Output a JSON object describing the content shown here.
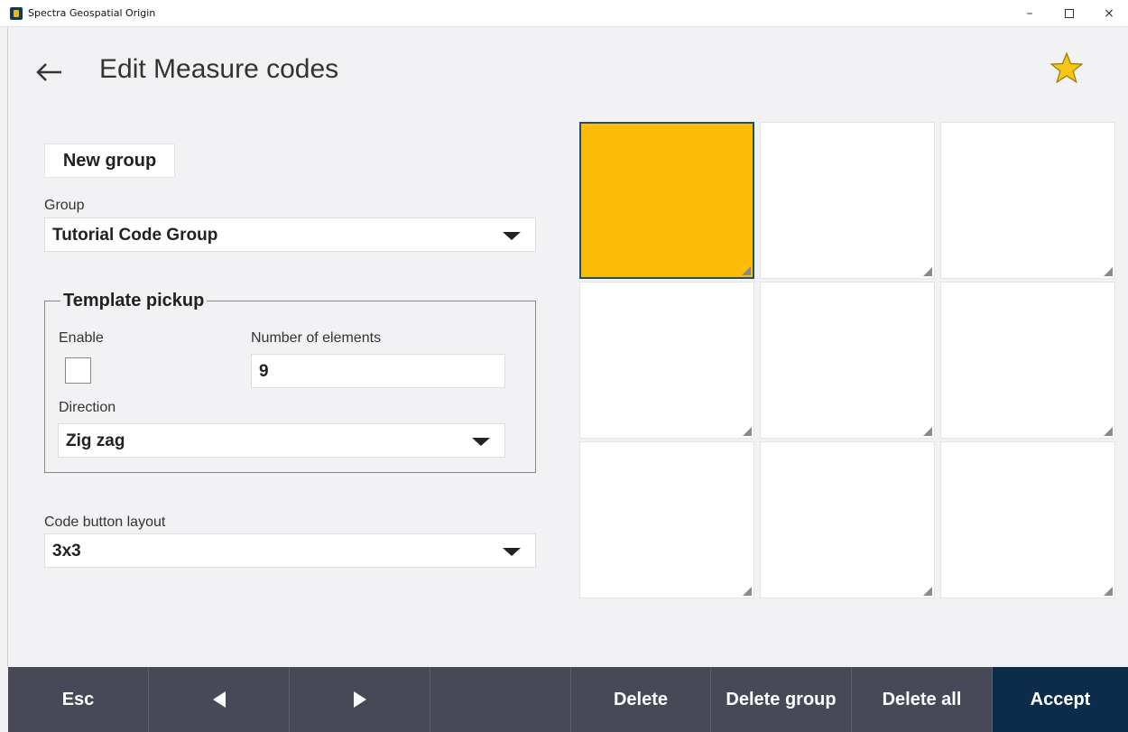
{
  "window": {
    "title": "Spectra Geospatial Origin",
    "minimize": "–",
    "close": "×"
  },
  "header": {
    "back_icon": "arrow-left-icon",
    "title": "Edit Measure codes",
    "favorite_icon": "star-icon",
    "favorite_color": "#f5c518"
  },
  "form": {
    "new_group_label": "New group",
    "group_label": "Group",
    "group_value": "Tutorial Code Group",
    "template_pickup": {
      "legend": "Template pickup",
      "enable_label": "Enable",
      "enable_checked": false,
      "number_label": "Number of elements",
      "number_value": "9",
      "direction_label": "Direction",
      "direction_value": "Zig zag"
    },
    "layout_label": "Code button layout",
    "layout_value": "3x3"
  },
  "code_grid": {
    "rows": 3,
    "cols": 3,
    "active_index": 0,
    "active_color": "#fbbc05"
  },
  "bottom_bar": {
    "esc": "Esc",
    "prev_icon": "triangle-left-icon",
    "next_icon": "triangle-right-icon",
    "delete": "Delete",
    "delete_group": "Delete group",
    "delete_all": "Delete all",
    "accept": "Accept",
    "accept_color": "#0c2c4a"
  }
}
